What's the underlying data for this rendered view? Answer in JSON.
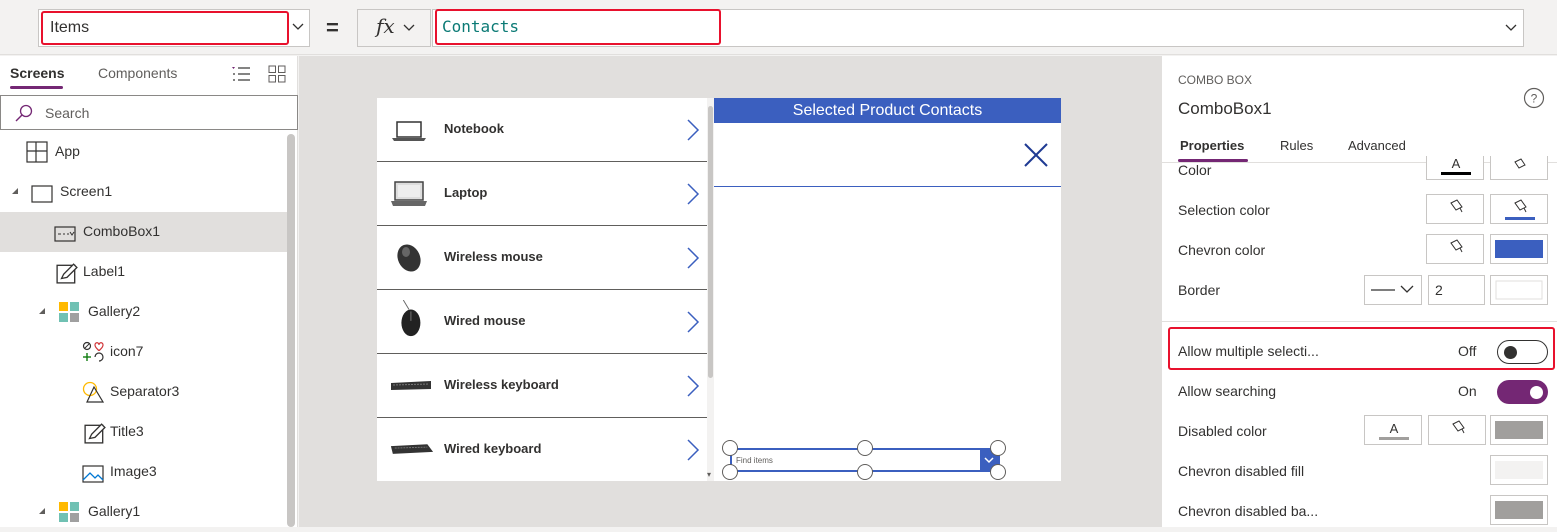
{
  "formula_bar": {
    "property": "Items",
    "equals": "=",
    "fx_label": "fx",
    "formula": "Contacts"
  },
  "tree_view": {
    "tabs": [
      "Screens",
      "Components"
    ],
    "search_placeholder": "Search",
    "nodes": [
      {
        "label": "App",
        "icon": "app-icon"
      },
      {
        "label": "Screen1",
        "icon": "screen-icon"
      },
      {
        "label": "ComboBox1",
        "icon": "combobox-icon",
        "selected": true
      },
      {
        "label": "Label1",
        "icon": "label-icon"
      },
      {
        "label": "Gallery2",
        "icon": "gallery-icon"
      },
      {
        "label": "icon7",
        "icon": "icons-icon"
      },
      {
        "label": "Separator3",
        "icon": "shapes-icon"
      },
      {
        "label": "Title3",
        "icon": "label-icon"
      },
      {
        "label": "Image3",
        "icon": "image-icon"
      },
      {
        "label": "Gallery1",
        "icon": "gallery-icon"
      }
    ]
  },
  "canvas": {
    "gallery_items": [
      "Notebook",
      "Laptop",
      "Wireless mouse",
      "Wired mouse",
      "Wireless keyboard",
      "Wired keyboard"
    ],
    "contacts_header": "Selected Product Contacts",
    "combo_placeholder": "Find items"
  },
  "properties": {
    "control_type": "COMBO BOX",
    "control_name": "ComboBox1",
    "tabs": [
      "Properties",
      "Rules",
      "Advanced"
    ],
    "rows": {
      "color": "Color",
      "selection_color": "Selection color",
      "chevron_color": "Chevron color",
      "border": "Border",
      "border_width": "2",
      "allow_multiple": "Allow multiple selecti...",
      "allow_multiple_state": "Off",
      "allow_searching": "Allow searching",
      "allow_searching_state": "On",
      "disabled_color": "Disabled color",
      "chevron_disabled_fill": "Chevron disabled fill",
      "chevron_disabled_ba": "Chevron disabled ba..."
    },
    "swatch_text": "A"
  },
  "colors": {
    "accent_purple": "#742774",
    "highlight_red": "#e8112d",
    "app_blue": "#3b5fbf",
    "formula_teal": "#0b7a75"
  }
}
